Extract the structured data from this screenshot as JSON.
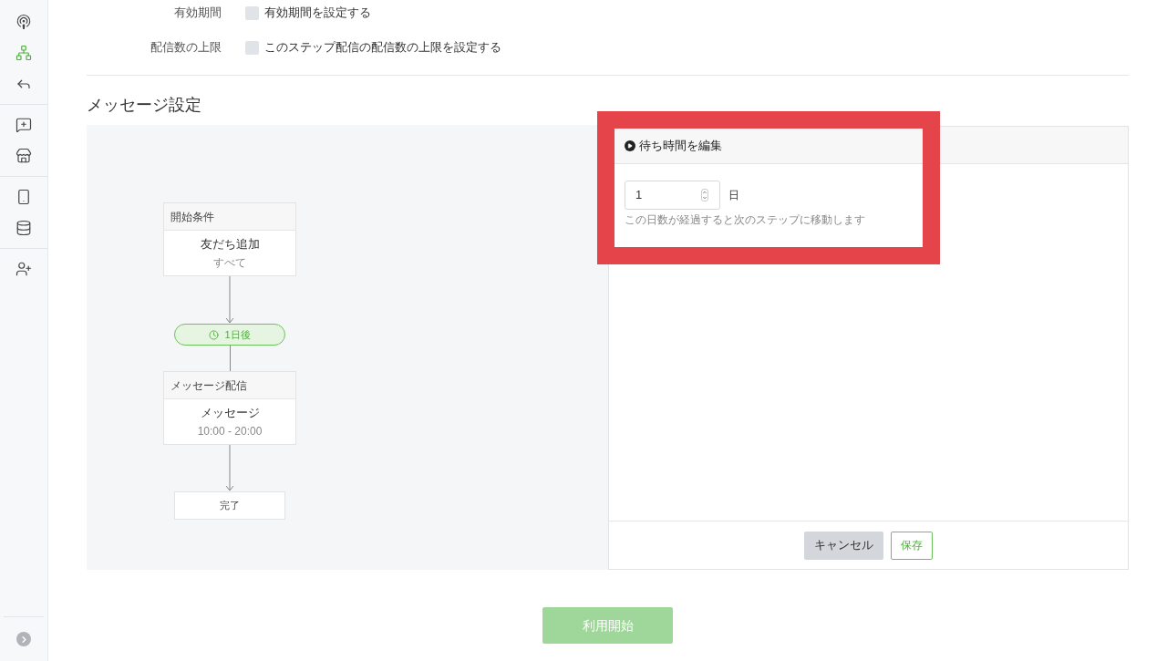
{
  "sidebar": {
    "groups": [
      [
        {
          "selected": false
        },
        {
          "selected": true
        },
        {
          "selected": false
        }
      ],
      [
        {
          "selected": false
        },
        {
          "selected": false
        }
      ],
      [
        {
          "selected": false
        },
        {
          "selected": false
        }
      ],
      [
        {
          "selected": false
        }
      ]
    ]
  },
  "settings": [
    {
      "label": "有効期間",
      "option": "有効期間を設定する",
      "checked": false
    },
    {
      "label": "配信数の上限",
      "option": "このステップ配信の配信数の上限を設定する",
      "checked": false
    }
  ],
  "section_title": "メッセージ設定",
  "flow": {
    "start": {
      "header": "開始条件",
      "title": "友だち追加",
      "subtitle": "すべて"
    },
    "wait": {
      "label": "1日後"
    },
    "message": {
      "header": "メッセージ配信",
      "title": "メッセージ",
      "subtitle": "10:00 - 20:00"
    },
    "end": {
      "label": "完了"
    }
  },
  "popover": {
    "title": "待ち時間を編集",
    "value": "1",
    "unit": "日",
    "help": "この日数が経過すると次のステップに移動します"
  },
  "panel_buttons": {
    "cancel": "キャンセル",
    "save": "保存"
  },
  "start_button": {
    "label": "利用開始",
    "disabled": true
  }
}
